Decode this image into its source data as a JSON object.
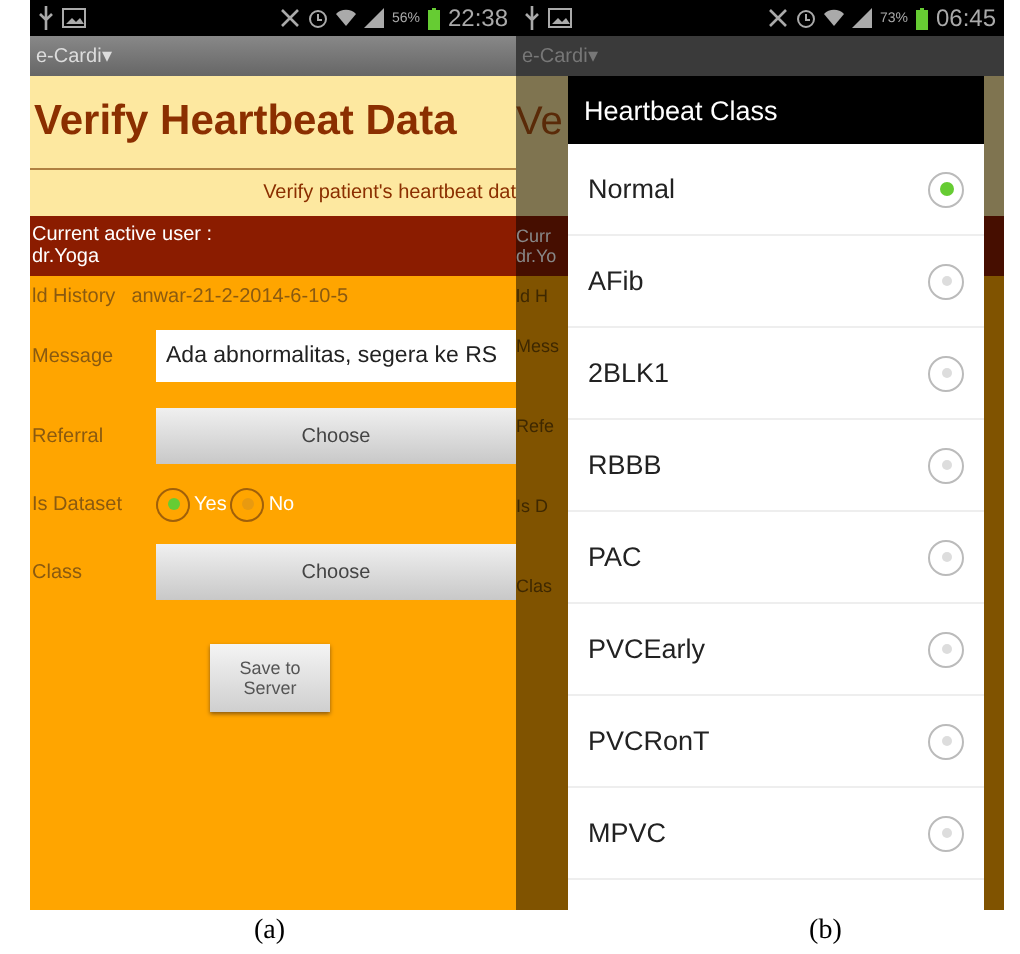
{
  "screen_a": {
    "status_bar": {
      "battery": "56%",
      "time": "22:38"
    },
    "app_name": "e-Cardi▾",
    "title": "Verify Heartbeat Data",
    "subtitle": "Verify patient's heartbeat dat",
    "user_label": "Current active user :",
    "user_name": "dr.Yoga",
    "history_label": "ld History",
    "history_value": "anwar-21-2-2014-6-10-5",
    "fields": [
      {
        "kind": "input",
        "label": "Message",
        "value": "Ada abnormalitas, segera ke RS"
      },
      {
        "kind": "button",
        "label": "Referral",
        "button": "Choose"
      },
      {
        "kind": "radio",
        "label": "Is Dataset",
        "options": [
          {
            "label": "Yes",
            "selected": true
          },
          {
            "label": "No",
            "selected": false
          }
        ]
      },
      {
        "kind": "button",
        "label": "Class",
        "button": "Choose"
      }
    ],
    "save_button": "Save to Server",
    "caption": "(a)"
  },
  "screen_b": {
    "status_bar": {
      "battery": "73%",
      "time": "06:45"
    },
    "app_name": "e-Cardi▾",
    "behind": {
      "title": "Ve",
      "user_label": "Curr",
      "user_name": "dr.Yo",
      "history_label": "ld H",
      "field_labels": [
        "Mess",
        "Refe",
        "Is D",
        "Clas"
      ]
    },
    "dialog": {
      "title": "Heartbeat Class",
      "options": [
        {
          "label": "Normal",
          "selected": true
        },
        {
          "label": "AFib",
          "selected": false
        },
        {
          "label": "2BLK1",
          "selected": false
        },
        {
          "label": "RBBB",
          "selected": false
        },
        {
          "label": "PAC",
          "selected": false
        },
        {
          "label": "PVCEarly",
          "selected": false
        },
        {
          "label": "PVCRonT",
          "selected": false
        },
        {
          "label": "MPVC",
          "selected": false
        }
      ]
    },
    "caption": "(b)"
  }
}
